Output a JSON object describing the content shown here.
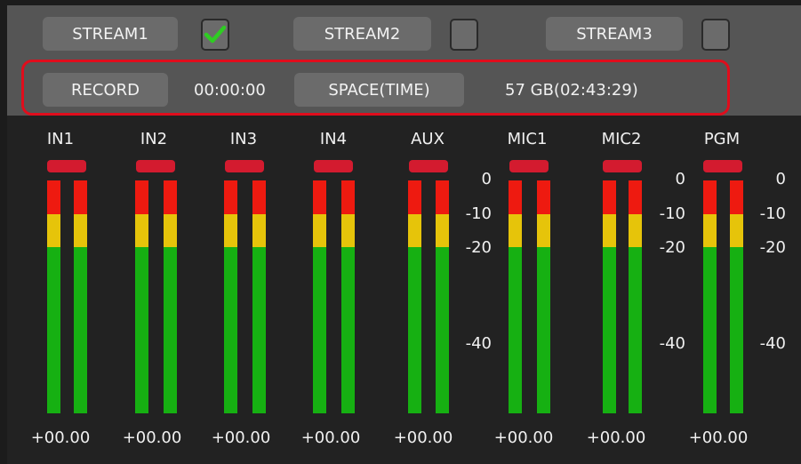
{
  "top": {
    "streams": [
      {
        "label": "STREAM1",
        "checked": true
      },
      {
        "label": "STREAM2",
        "checked": false
      },
      {
        "label": "STREAM3",
        "checked": false
      }
    ],
    "record_label": "RECORD",
    "record_time": "00:00:00",
    "space_label": "SPACE(TIME)",
    "space_value": "57 GB(02:43:29)"
  },
  "channels": [
    {
      "label": "IN1",
      "gain": "+00.00"
    },
    {
      "label": "IN2",
      "gain": "+00.00"
    },
    {
      "label": "IN3",
      "gain": "+00.00"
    },
    {
      "label": "IN4",
      "gain": "+00.00"
    },
    {
      "label": "AUX",
      "gain": "+00.00"
    },
    {
      "label": "MIC1",
      "gain": "+00.00"
    },
    {
      "label": "MIC2",
      "gain": "+00.00"
    },
    {
      "label": "PGM",
      "gain": "+00.00"
    }
  ],
  "scale_labels": [
    "0",
    "-10",
    "-20",
    "-40"
  ],
  "colors": {
    "highlight": "#e00d1c",
    "check": "#2ecc22",
    "meter_red": "#ee1a10",
    "meter_yellow": "#e6c40a",
    "meter_green": "#16b012",
    "peak": "#d31b2f"
  }
}
